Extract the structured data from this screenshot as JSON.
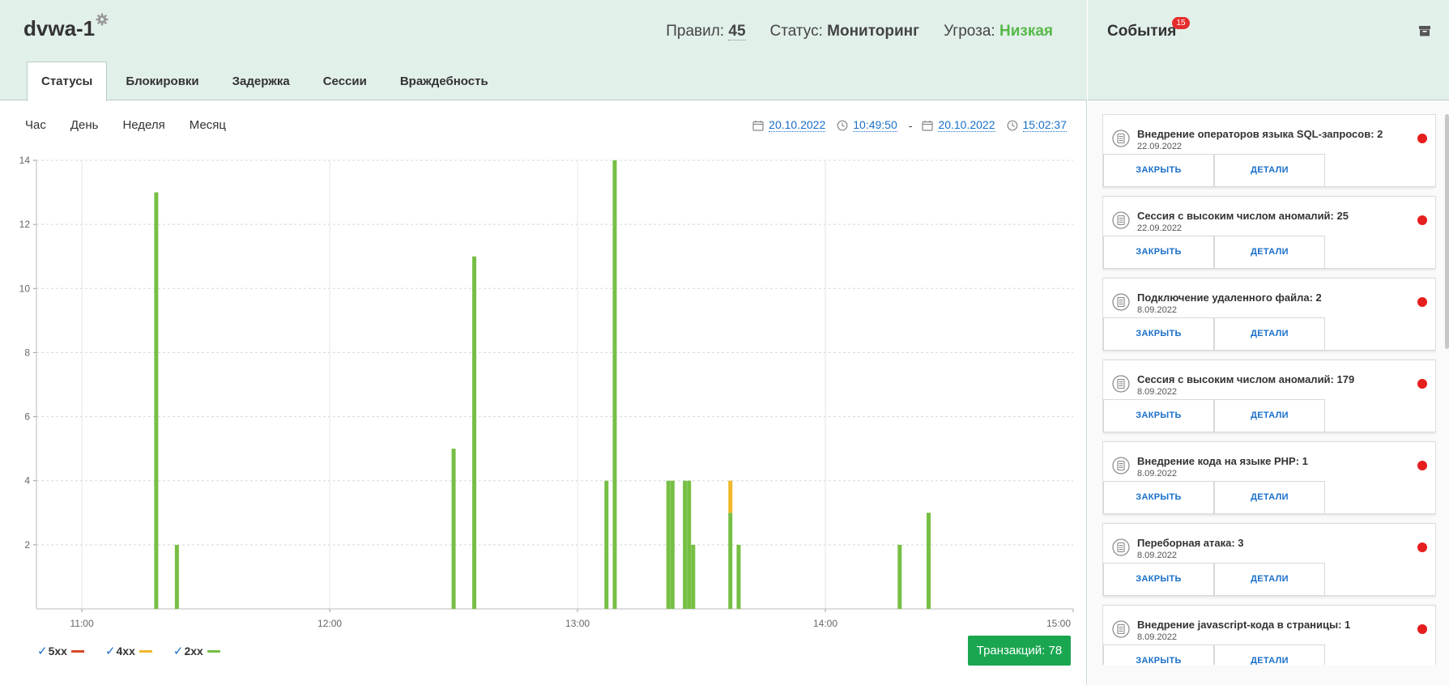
{
  "header": {
    "app_name": "dvwa-1",
    "stats": {
      "rules_label": "Правил:",
      "rules_value": "45",
      "status_label": "Статус:",
      "status_value": "Мониторинг",
      "threat_label": "Угроза:",
      "threat_value": "Низкая"
    },
    "tabs": [
      {
        "label": "Статусы",
        "active": true
      },
      {
        "label": "Блокировки"
      },
      {
        "label": "Задержка"
      },
      {
        "label": "Сессии"
      },
      {
        "label": "Враждебность"
      }
    ]
  },
  "range": {
    "periods": [
      "Час",
      "День",
      "Неделя",
      "Месяц"
    ],
    "start_date": "20.10.2022",
    "start_time": "10:49:50",
    "separator": "-",
    "end_date": "20.10.2022",
    "end_time": "15:02:37"
  },
  "chart_data": {
    "type": "bar",
    "x_unit": "time (HH:MM)",
    "xlim": [
      "10:49",
      "15:00"
    ],
    "ylim": [
      0,
      14
    ],
    "x_ticks": [
      "11:00",
      "12:00",
      "13:00",
      "14:00",
      "15:00"
    ],
    "y_ticks": [
      "2",
      "4",
      "6",
      "8",
      "10",
      "12",
      "14"
    ],
    "grid": true,
    "stacked": true,
    "series": [
      {
        "name": "5xx",
        "color": "#d9472b",
        "points": []
      },
      {
        "name": "4xx",
        "color": "#f0b82a",
        "points": [
          {
            "x": "13:37",
            "y": 1
          }
        ]
      },
      {
        "name": "2xx",
        "color": "#77bf44",
        "points": [
          {
            "x": "11:18",
            "y": 13
          },
          {
            "x": "11:23",
            "y": 2
          },
          {
            "x": "12:30",
            "y": 5
          },
          {
            "x": "12:35",
            "y": 11
          },
          {
            "x": "13:07",
            "y": 4
          },
          {
            "x": "13:09",
            "y": 14
          },
          {
            "x": "13:22",
            "y": 4
          },
          {
            "x": "13:23",
            "y": 4
          },
          {
            "x": "13:26",
            "y": 4
          },
          {
            "x": "13:27",
            "y": 4
          },
          {
            "x": "13:28",
            "y": 2
          },
          {
            "x": "13:37",
            "y": 3
          },
          {
            "x": "13:39",
            "y": 2
          },
          {
            "x": "14:18",
            "y": 2
          },
          {
            "x": "14:25",
            "y": 3
          }
        ]
      }
    ]
  },
  "legend": [
    {
      "label": "5xx",
      "color": "#d9472b"
    },
    {
      "label": "4xx",
      "color": "#f0b82a"
    },
    {
      "label": "2xx",
      "color": "#77bf44"
    }
  ],
  "legend_check": "✓",
  "transactions_label": "Транзакций: 78",
  "events": {
    "title": "События",
    "badge": "15",
    "close_label": "ЗАКРЫТЬ",
    "details_label": "ДЕТАЛИ",
    "items": [
      {
        "title": "Внедрение операторов языка SQL-запросов: 2",
        "date": "22.09.2022"
      },
      {
        "title": "Сессия с высоким числом аномалий: 25",
        "date": "22.09.2022"
      },
      {
        "title": "Подключение удаленного файла: 2",
        "date": "8.09.2022"
      },
      {
        "title": "Сессия с высоким числом аномалий: 179",
        "date": "8.09.2022"
      },
      {
        "title": "Внедрение кода на языке PHP: 1",
        "date": "8.09.2022"
      },
      {
        "title": "Переборная атака: 3",
        "date": "8.09.2022"
      },
      {
        "title": "Внедрение javascript-кода в страницы: 1",
        "date": "8.09.2022"
      }
    ]
  }
}
